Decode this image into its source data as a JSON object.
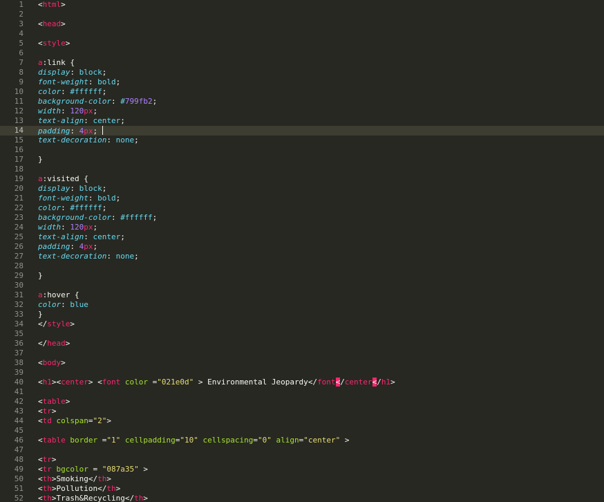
{
  "editor": {
    "theme_colors": {
      "background": "#272822",
      "gutter_text": "#90908a",
      "current_line": "#3e3d32",
      "tag": "#f92672",
      "property": "#66d9ef",
      "number": "#ae81ff",
      "attribute": "#a6e22e",
      "string": "#e6db74",
      "text": "#f8f8f2"
    },
    "current_line": 14,
    "lines": [
      [
        [
          "p",
          "<"
        ],
        [
          "tag",
          "html"
        ],
        [
          "p",
          ">"
        ]
      ],
      [],
      [
        [
          "p",
          "<"
        ],
        [
          "tag",
          "head"
        ],
        [
          "p",
          ">"
        ]
      ],
      [],
      [
        [
          "p",
          "<"
        ],
        [
          "tag",
          "style"
        ],
        [
          "p",
          ">"
        ]
      ],
      [],
      [
        [
          "tag",
          "a"
        ],
        [
          "sel",
          ":link {"
        ]
      ],
      [
        [
          "prop",
          "display"
        ],
        [
          "p",
          ": "
        ],
        [
          "val",
          "block"
        ],
        [
          "p",
          ";"
        ]
      ],
      [
        [
          "prop",
          "font-weight"
        ],
        [
          "p",
          ": "
        ],
        [
          "val",
          "bold"
        ],
        [
          "p",
          ";"
        ]
      ],
      [
        [
          "prop",
          "color"
        ],
        [
          "p",
          ": "
        ],
        [
          "val",
          "#ffffff"
        ],
        [
          "p",
          ";"
        ]
      ],
      [
        [
          "prop",
          "background-color"
        ],
        [
          "p",
          ": "
        ],
        [
          "val",
          "#"
        ],
        [
          "num",
          "799fb2"
        ],
        [
          "p",
          ";"
        ]
      ],
      [
        [
          "prop",
          "width"
        ],
        [
          "p",
          ": "
        ],
        [
          "num",
          "120"
        ],
        [
          "unit",
          "px"
        ],
        [
          "p",
          ";"
        ]
      ],
      [
        [
          "prop",
          "text-align"
        ],
        [
          "p",
          ": "
        ],
        [
          "val",
          "center"
        ],
        [
          "p",
          ";"
        ]
      ],
      [
        [
          "prop",
          "padding"
        ],
        [
          "p",
          ": "
        ],
        [
          "num",
          "4"
        ],
        [
          "unit",
          "px"
        ],
        [
          "p",
          "; "
        ],
        [
          "caret",
          ""
        ]
      ],
      [
        [
          "prop",
          "text-decoration"
        ],
        [
          "p",
          ": "
        ],
        [
          "val",
          "none"
        ],
        [
          "p",
          ";"
        ]
      ],
      [],
      [
        [
          "p",
          "}"
        ]
      ],
      [],
      [
        [
          "tag",
          "a"
        ],
        [
          "sel",
          ":visited {"
        ]
      ],
      [
        [
          "prop",
          "display"
        ],
        [
          "p",
          ": "
        ],
        [
          "val",
          "block"
        ],
        [
          "p",
          ";"
        ]
      ],
      [
        [
          "prop",
          "font-weight"
        ],
        [
          "p",
          ": "
        ],
        [
          "val",
          "bold"
        ],
        [
          "p",
          ";"
        ]
      ],
      [
        [
          "prop",
          "color"
        ],
        [
          "p",
          ": "
        ],
        [
          "val",
          "#ffffff"
        ],
        [
          "p",
          ";"
        ]
      ],
      [
        [
          "prop",
          "background-color"
        ],
        [
          "p",
          ": "
        ],
        [
          "val",
          "#ffffff"
        ],
        [
          "p",
          ";"
        ]
      ],
      [
        [
          "prop",
          "width"
        ],
        [
          "p",
          ": "
        ],
        [
          "num",
          "120"
        ],
        [
          "unit",
          "px"
        ],
        [
          "p",
          ";"
        ]
      ],
      [
        [
          "prop",
          "text-align"
        ],
        [
          "p",
          ": "
        ],
        [
          "val",
          "center"
        ],
        [
          "p",
          ";"
        ]
      ],
      [
        [
          "prop",
          "padding"
        ],
        [
          "p",
          ": "
        ],
        [
          "num",
          "4"
        ],
        [
          "unit",
          "px"
        ],
        [
          "p",
          ";"
        ]
      ],
      [
        [
          "prop",
          "text-decoration"
        ],
        [
          "p",
          ": "
        ],
        [
          "val",
          "none"
        ],
        [
          "p",
          ";"
        ]
      ],
      [],
      [
        [
          "p",
          "}"
        ]
      ],
      [],
      [
        [
          "tag",
          "a"
        ],
        [
          "sel",
          ":hover {"
        ]
      ],
      [
        [
          "prop",
          "color"
        ],
        [
          "p",
          ": "
        ],
        [
          "val",
          "blue"
        ]
      ],
      [
        [
          "p",
          "}"
        ]
      ],
      [
        [
          "p",
          "</"
        ],
        [
          "tag",
          "style"
        ],
        [
          "p",
          ">"
        ]
      ],
      [],
      [
        [
          "p",
          "</"
        ],
        [
          "tag",
          "head"
        ],
        [
          "p",
          ">"
        ]
      ],
      [],
      [
        [
          "p",
          "<"
        ],
        [
          "tag",
          "body"
        ],
        [
          "p",
          ">"
        ]
      ],
      [],
      [
        [
          "p",
          "<"
        ],
        [
          "tag",
          "h1"
        ],
        [
          "p",
          "><"
        ],
        [
          "tag",
          "center"
        ],
        [
          "p",
          "> <"
        ],
        [
          "tag",
          "font"
        ],
        [
          "p",
          " "
        ],
        [
          "attr",
          "color"
        ],
        [
          "p",
          " ="
        ],
        [
          "str",
          "\"021e0d\""
        ],
        [
          "p",
          " > "
        ],
        [
          "text",
          "Environmental Jeopardy"
        ],
        [
          "p",
          "</"
        ],
        [
          "tag",
          "font"
        ],
        [
          "err",
          "<"
        ],
        [
          "p",
          "/"
        ],
        [
          "tag",
          "center"
        ],
        [
          "err",
          "<"
        ],
        [
          "p",
          "/"
        ],
        [
          "tag",
          "h1"
        ],
        [
          "p",
          ">"
        ]
      ],
      [],
      [
        [
          "p",
          "<"
        ],
        [
          "tag",
          "table"
        ],
        [
          "p",
          ">"
        ]
      ],
      [
        [
          "p",
          "<"
        ],
        [
          "tag",
          "tr"
        ],
        [
          "p",
          ">"
        ]
      ],
      [
        [
          "p",
          "<"
        ],
        [
          "tag",
          "td"
        ],
        [
          "p",
          " "
        ],
        [
          "attr",
          "colspan"
        ],
        [
          "p",
          "="
        ],
        [
          "str",
          "\"2\""
        ],
        [
          "p",
          ">"
        ]
      ],
      [],
      [
        [
          "p",
          "<"
        ],
        [
          "tag",
          "table"
        ],
        [
          "p",
          " "
        ],
        [
          "attr",
          "border"
        ],
        [
          "p",
          " ="
        ],
        [
          "str",
          "\"1\""
        ],
        [
          "p",
          " "
        ],
        [
          "attr",
          "cellpadding"
        ],
        [
          "p",
          "="
        ],
        [
          "str",
          "\"10\""
        ],
        [
          "p",
          " "
        ],
        [
          "attr",
          "cellspacing"
        ],
        [
          "p",
          "="
        ],
        [
          "str",
          "\"0\""
        ],
        [
          "p",
          " "
        ],
        [
          "attr",
          "align"
        ],
        [
          "p",
          "="
        ],
        [
          "str",
          "\"center\""
        ],
        [
          "p",
          " >"
        ]
      ],
      [],
      [
        [
          "p",
          "<"
        ],
        [
          "tag",
          "tr"
        ],
        [
          "p",
          ">"
        ]
      ],
      [
        [
          "p",
          "<"
        ],
        [
          "tag",
          "tr"
        ],
        [
          "p",
          " "
        ],
        [
          "attr",
          "bgcolor"
        ],
        [
          "p",
          " = "
        ],
        [
          "str",
          "\"087a35\""
        ],
        [
          "p",
          " >"
        ]
      ],
      [
        [
          "p",
          "<"
        ],
        [
          "tag",
          "th"
        ],
        [
          "p",
          ">"
        ],
        [
          "text",
          "Smoking"
        ],
        [
          "p",
          "</"
        ],
        [
          "tag",
          "th"
        ],
        [
          "p",
          ">"
        ]
      ],
      [
        [
          "p",
          "<"
        ],
        [
          "tag",
          "th"
        ],
        [
          "p",
          ">"
        ],
        [
          "text",
          "Pollution"
        ],
        [
          "p",
          "</"
        ],
        [
          "tag",
          "th"
        ],
        [
          "p",
          ">"
        ]
      ],
      [
        [
          "p",
          "<"
        ],
        [
          "tag",
          "th"
        ],
        [
          "p",
          ">"
        ],
        [
          "text",
          "Trash&Recycling"
        ],
        [
          "p",
          "</"
        ],
        [
          "tag",
          "th"
        ],
        [
          "p",
          ">"
        ]
      ]
    ]
  }
}
